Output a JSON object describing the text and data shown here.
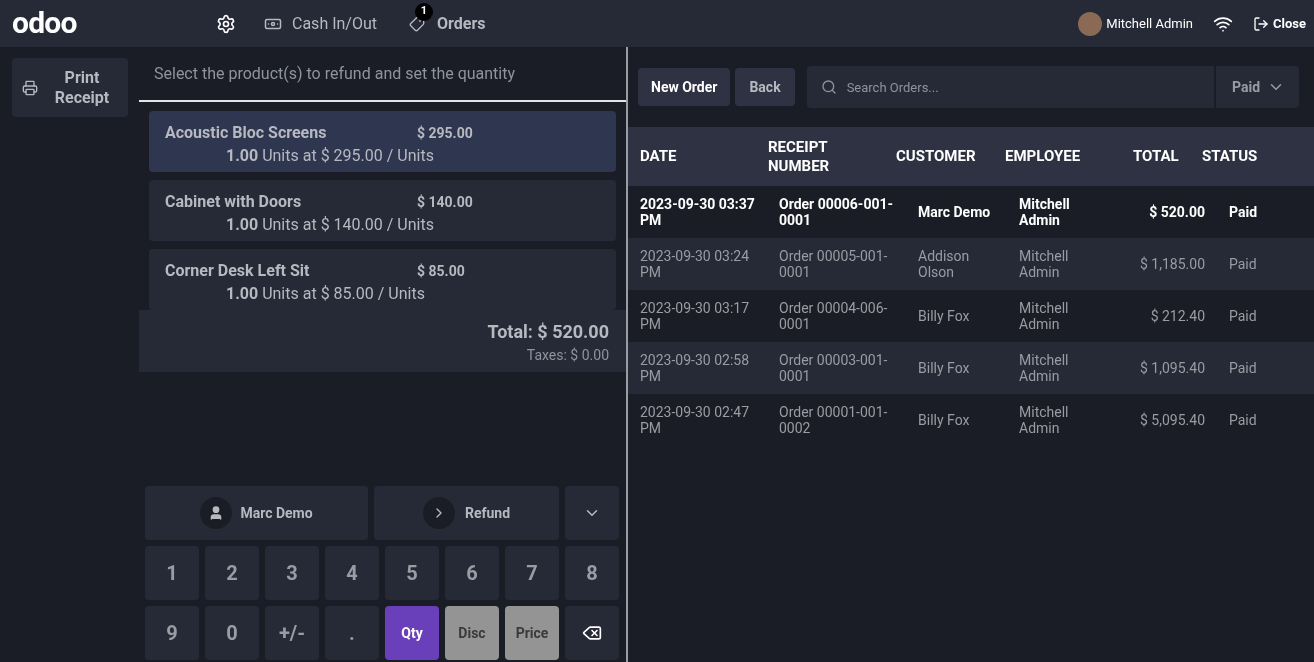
{
  "header": {
    "logo": "odoo",
    "cash_label": "Cash In/Out",
    "orders_label": "Orders",
    "orders_badge": "1",
    "user": "Mitchell Admin",
    "close": "Close"
  },
  "sidebar": {
    "print_button": "Print Receipt"
  },
  "refund": {
    "instruction": "Select the product(s) to refund and set the quantity",
    "lines": [
      {
        "name": "Acoustic Bloc Screens",
        "price": "$ 295.00",
        "qty": "1.00",
        "detail": "Units at $ 295.00 / Units",
        "selected": true
      },
      {
        "name": "Cabinet with Doors",
        "price": "$ 140.00",
        "qty": "1.00",
        "detail": "Units at $ 140.00 / Units",
        "selected": false
      },
      {
        "name": "Corner Desk Left Sit",
        "price": "$ 85.00",
        "qty": "1.00",
        "detail": "Units at $ 85.00 / Units",
        "selected": false
      }
    ],
    "total": "Total: $ 520.00",
    "taxes": "Taxes: $ 0.00",
    "customer_button": "Marc Demo",
    "refund_button": "Refund",
    "keys": [
      {
        "kind": "key",
        "label": "1"
      },
      {
        "kind": "key",
        "label": "2"
      },
      {
        "kind": "key",
        "label": "3"
      },
      {
        "kind": "key",
        "label": "4"
      },
      {
        "kind": "key",
        "label": "5"
      },
      {
        "kind": "key",
        "label": "6"
      },
      {
        "kind": "key",
        "label": "7"
      },
      {
        "kind": "key",
        "label": "8"
      },
      {
        "kind": "key",
        "label": "9"
      },
      {
        "kind": "key",
        "label": "0"
      },
      {
        "kind": "key",
        "label": "+/-"
      },
      {
        "kind": "key",
        "label": "."
      },
      {
        "kind": "mode",
        "label": "Qty",
        "selected": true
      },
      {
        "kind": "mode",
        "label": "Disc",
        "selected": false
      },
      {
        "kind": "mode",
        "label": "Price",
        "selected": false
      },
      {
        "kind": "backspace"
      }
    ]
  },
  "orders": {
    "new_order": "New Order",
    "back": "Back",
    "search": {
      "placeholder": "Search Orders..."
    },
    "filter": "Paid",
    "columns": [
      "DATE",
      "RECEIPT NUMBER",
      "CUSTOMER",
      "EMPLOYEE",
      "TOTAL",
      "STATUS"
    ],
    "rows": [
      {
        "date": "2023-09-30 03:37 PM",
        "receipt": "Order 00006-001-0001",
        "customer": "Marc Demo",
        "employee": "Mitchell Admin",
        "total": "$ 520.00",
        "status": "Paid",
        "selected": true
      },
      {
        "date": "2023-09-30 03:24 PM",
        "receipt": "Order 00005-001-0001",
        "customer": "Addison Olson",
        "employee": "Mitchell Admin",
        "total": "$ 1,185.00",
        "status": "Paid",
        "selected": false
      },
      {
        "date": "2023-09-30 03:17 PM",
        "receipt": "Order 00004-006-0001",
        "customer": "Billy Fox",
        "employee": "Mitchell Admin",
        "total": "$ 212.40",
        "status": "Paid",
        "selected": false
      },
      {
        "date": "2023-09-30 02:58 PM",
        "receipt": "Order 00003-001-0001",
        "customer": "Billy Fox",
        "employee": "Mitchell Admin",
        "total": "$ 1,095.40",
        "status": "Paid",
        "selected": false
      },
      {
        "date": "2023-09-30 02:47 PM",
        "receipt": "Order 00001-001-0002",
        "customer": "Billy Fox",
        "employee": "Mitchell Admin",
        "total": "$ 5,095.40",
        "status": "Paid",
        "selected": false
      }
    ]
  }
}
